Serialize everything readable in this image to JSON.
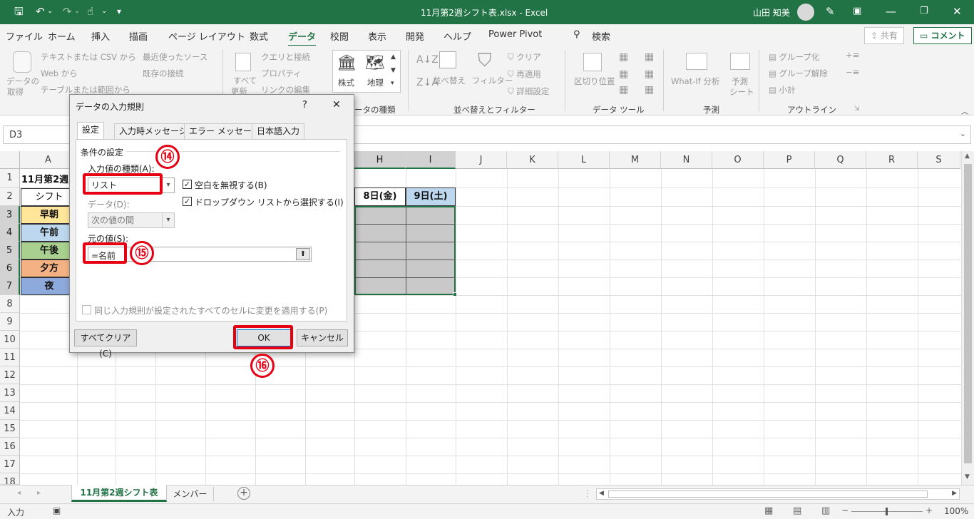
{
  "titlebar": {
    "filename": "11月第2週シフト表.xlsx  -  Excel",
    "user": "山田 知美"
  },
  "menu": {
    "tabs": [
      "ファイル",
      "ホーム",
      "挿入",
      "描画",
      "ページ レイアウト",
      "数式",
      "データ",
      "校閲",
      "表示",
      "開発",
      "ヘルプ",
      "Power Pivot"
    ],
    "search": "検索",
    "share": "共有",
    "comment": "コメント"
  },
  "ribbon": {
    "get_data": "データの",
    "get_data2": "取得",
    "text_csv": "テキストまたは CSV から",
    "web": "Web から",
    "table_range": "テーブルまたは範囲から",
    "recent": "最近使ったソース",
    "existing": "既存の接続",
    "refresh_all": "すべて",
    "refresh_all2": "更新",
    "queries": "クエリと接続",
    "properties": "プロパティ",
    "edit_links": "リンクの編集",
    "stocks": "株式",
    "geography": "地理",
    "data_types_group": "ータの種類",
    "sort": "並べ替え",
    "filter": "フィルター",
    "clear": "クリア",
    "reapply": "再適用",
    "advanced": "詳細設定",
    "sort_filter_group": "並べ替えとフィルター",
    "text_to_columns": "区切り位置",
    "data_tools_group": "データ ツール",
    "what_if": "What-If 分析",
    "forecast_sheet": "予測",
    "forecast_sheet2": "シート",
    "forecast_group": "予測",
    "group": "グループ化",
    "ungroup": "グループ解除",
    "subtotal": "小計",
    "outline_group": "アウトライン"
  },
  "namebox": "D3",
  "columns": [
    "A",
    "H",
    "I",
    "J",
    "K",
    "L",
    "M",
    "N",
    "O",
    "P",
    "Q",
    "R",
    "S"
  ],
  "rows": [
    "1",
    "2",
    "3",
    "4",
    "5",
    "6",
    "7",
    "8",
    "9",
    "10",
    "11",
    "12",
    "13",
    "14",
    "15",
    "16",
    "17",
    "18"
  ],
  "cells": {
    "a1": "11月第2週",
    "a2": "シフト",
    "h2": "8日(金)",
    "i2": "9日(土)",
    "shifts": [
      "早朝",
      "午前",
      "午後",
      "夕方",
      "夜"
    ],
    "shift_colors": [
      "#ffe699",
      "#bdd7ee",
      "#a9d08e",
      "#f4b183",
      "#8ea9db"
    ]
  },
  "dialog": {
    "title": "データの入力規則",
    "help": "?",
    "close": "✕",
    "tabs": [
      "設定",
      "入力時メッセージ",
      "エラー メッセージ",
      "日本語入力"
    ],
    "criteria_label": "条件の設定",
    "allow_label": "入力値の種類(A):",
    "allow_value": "リスト",
    "ignore_blank": "空白を無視する(B)",
    "in_cell_dropdown": "ドロップダウン リストから選択する(I)",
    "data_label": "データ(D):",
    "data_value": "次の値の間",
    "source_label": "元の値(S):",
    "source_value": "=名前",
    "apply_all": "同じ入力規則が設定されたすべてのセルに変更を適用する(P)",
    "clear_all": "すべてクリア(C)",
    "ok": "OK",
    "cancel": "キャンセル"
  },
  "badges": [
    "⑭",
    "⑮",
    "⑯"
  ],
  "sheets": [
    "11月第2週シフト表",
    "メンバー"
  ],
  "status": {
    "mode": "入力",
    "zoom": "100%"
  },
  "colors": {
    "excel_green": "#217346",
    "highlight_red": "#e60012"
  }
}
